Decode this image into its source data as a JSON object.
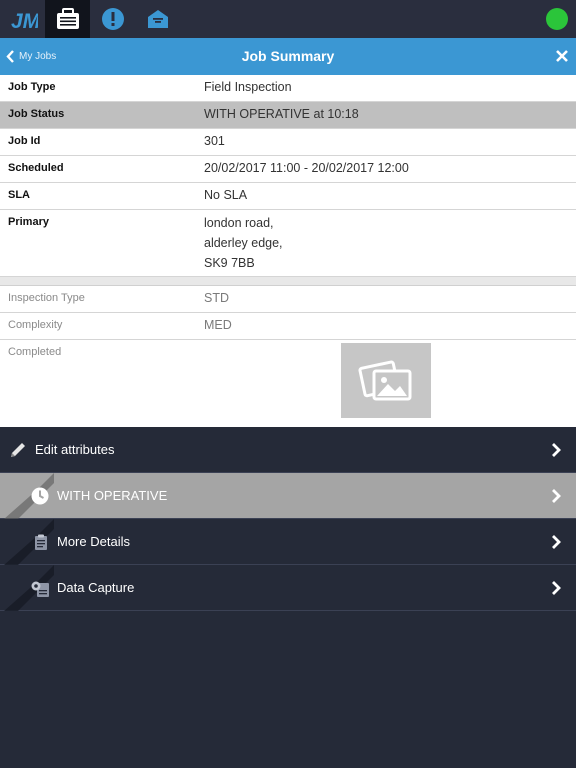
{
  "topbar": {
    "logo_icon": "jm-logo",
    "tabs": [
      {
        "icon": "briefcase-icon",
        "active": true
      },
      {
        "icon": "alert-icon",
        "active": false
      },
      {
        "icon": "inbox-icon",
        "active": false
      }
    ],
    "status_color": "#2bc53a"
  },
  "titlebar": {
    "back_label": "My Jobs",
    "title": "Job Summary"
  },
  "details": {
    "job_type_label": "Job Type",
    "job_type_value": "Field Inspection",
    "job_status_label": "Job Status",
    "job_status_value": "WITH OPERATIVE at 10:18",
    "job_id_label": "Job Id",
    "job_id_value": "301",
    "scheduled_label": "Scheduled",
    "scheduled_value": "20/02/2017 11:00 - 20/02/2017 12:00",
    "sla_label": "SLA",
    "sla_value": "No SLA",
    "primary_label": "Primary",
    "primary_line1": "london road,",
    "primary_line2": "alderley edge,",
    "primary_line3": "SK9 7BB"
  },
  "attributes": {
    "inspection_type_label": "Inspection Type",
    "inspection_type_value": "STD",
    "complexity_label": "Complexity",
    "complexity_value": "MED",
    "completed_label": "Completed"
  },
  "menu": {
    "edit_label": "Edit attributes",
    "status_label": "WITH OPERATIVE",
    "more_label": "More Details",
    "capture_label": "Data Capture"
  },
  "colors": {
    "accent": "#3b97d3",
    "link": "#4ab0d6",
    "menu_bg": "#252a38"
  }
}
